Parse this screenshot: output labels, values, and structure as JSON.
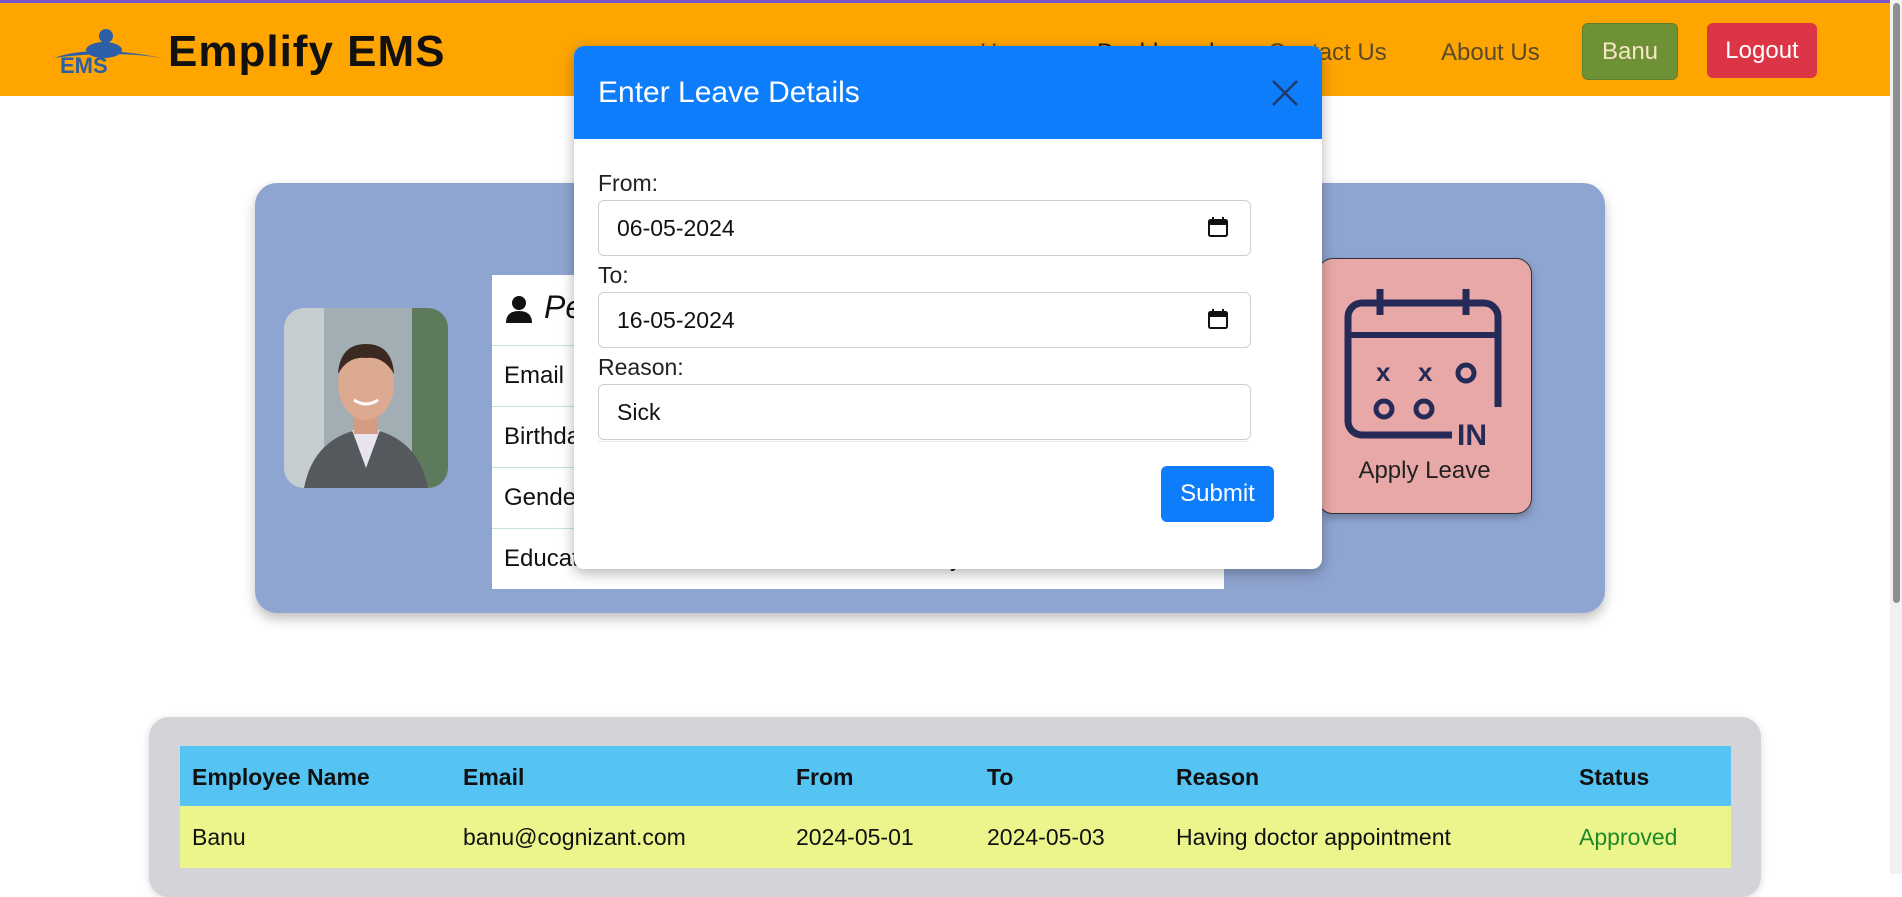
{
  "navbar": {
    "brand": "Emplify EMS",
    "links": [
      "Home",
      "Dashboard",
      "Contact Us",
      "About Us"
    ],
    "user_button": "Banu",
    "logout_button": "Logout",
    "colors": {
      "background": "#ffa500",
      "user_button": "#6f9136",
      "logout_button": "#dc3545"
    }
  },
  "profile": {
    "section_title": "Pe",
    "rows": [
      "Email",
      "Birthda",
      "Gende",
      "Educat"
    ],
    "education_trail": "y",
    "card_color": "#8fa5d1"
  },
  "apply_leave": {
    "label": "Apply Leave",
    "icon": "calendar-in-icon",
    "color": "#e8a8a8"
  },
  "modal": {
    "title": "Enter Leave Details",
    "from_label": "From:",
    "from_value": "06-05-2024",
    "to_label": "To:",
    "to_value": "16-05-2024",
    "reason_label": "Reason:",
    "reason_value": "Sick",
    "submit_label": "Submit",
    "header_color": "#0d7dfb"
  },
  "leave_table": {
    "columns": [
      "Employee Name",
      "Email",
      "From",
      "To",
      "Reason",
      "Status"
    ],
    "rows": [
      [
        "Banu",
        "banu@cognizant.com",
        "2024-05-01",
        "2024-05-03",
        "Having doctor appointment",
        "Approved"
      ]
    ],
    "header_color": "#55c4f2",
    "row_color": "#ebf58c"
  }
}
